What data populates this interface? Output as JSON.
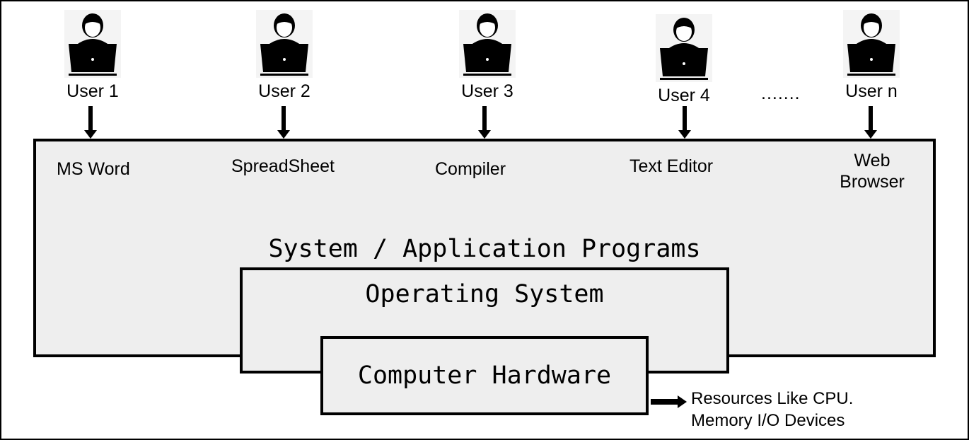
{
  "users": [
    {
      "label": "User 1"
    },
    {
      "label": "User 2"
    },
    {
      "label": "User 3"
    },
    {
      "label": "User 4"
    },
    {
      "label": "User n"
    }
  ],
  "ellipsis": ".......",
  "applications": [
    {
      "label": "MS Word"
    },
    {
      "label": "SpreadSheet"
    },
    {
      "label": "Compiler"
    },
    {
      "label": "Text Editor"
    },
    {
      "label": "Web\nBrowser",
      "line1": "Web",
      "line2": "Browser"
    }
  ],
  "layers": {
    "programs": "System / Application Programs",
    "os": "Operating System",
    "hardware": "Computer Hardware"
  },
  "resources": {
    "line1": "Resources Like CPU.",
    "line2": "Memory I/O Devices"
  },
  "colors": {
    "box_fill": "#eeeeee",
    "stroke": "#000000"
  }
}
